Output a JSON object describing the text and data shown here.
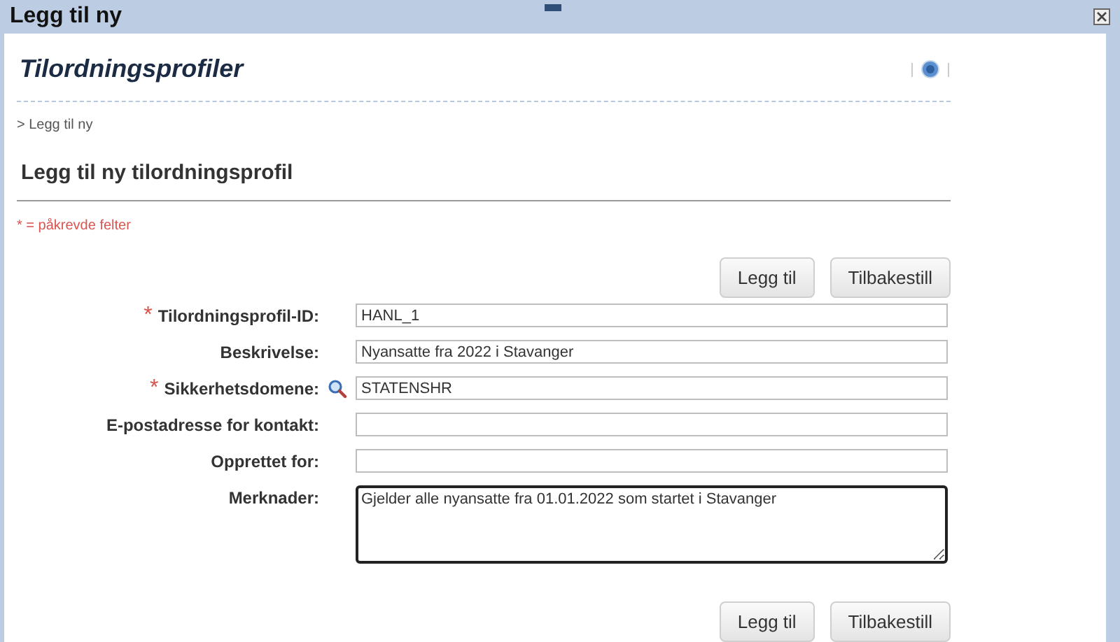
{
  "window": {
    "title": "Legg til ny"
  },
  "page": {
    "title": "Tilordningsprofiler",
    "breadcrumb": "> Legg til ny",
    "heading": "Legg til ny tilordningsprofil",
    "required_note": "* = påkrevde felter",
    "required_symbol": "*"
  },
  "buttons_top": [
    "Legg til",
    "Tilbakestill"
  ],
  "fields": [
    {
      "label": "Tilordningsprofil-ID:",
      "required": true,
      "lookup": false,
      "kind": "text",
      "value": "HANL_1",
      "focused": false
    },
    {
      "label": "Beskrivelse:",
      "required": false,
      "lookup": false,
      "kind": "text",
      "value": "Nyansatte fra 2022 i Stavanger",
      "focused": false
    },
    {
      "label": "Sikkerhetsdomene:",
      "required": true,
      "lookup": true,
      "kind": "text",
      "value": "STATENSHR",
      "focused": false
    },
    {
      "label": "E-postadresse for kontakt:",
      "required": false,
      "lookup": false,
      "kind": "text",
      "focused": false
    },
    {
      "label": "Opprettet for:",
      "required": false,
      "lookup": false,
      "kind": "text",
      "focused": false
    },
    {
      "label": "Merknader:",
      "required": false,
      "lookup": false,
      "kind": "textarea",
      "value": "Gjelder alle nyansatte fra 01.01.2022 som startet i Stavanger",
      "focused": true
    }
  ],
  "buttons_bottom": [
    "Legg til",
    "Tilbakestill"
  ]
}
